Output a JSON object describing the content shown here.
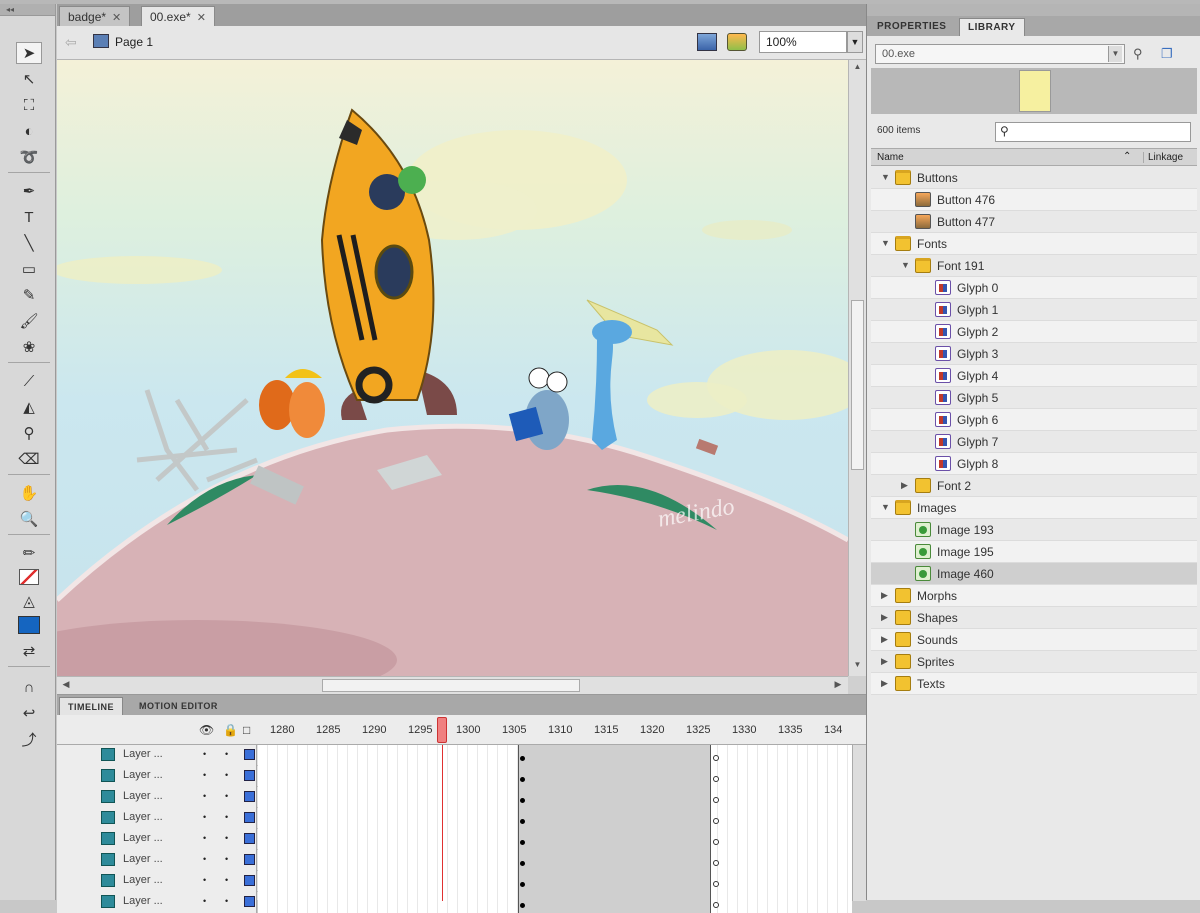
{
  "document_tabs": [
    {
      "label": "badge*",
      "active": false
    },
    {
      "label": "00.exe*",
      "active": true
    }
  ],
  "editbar": {
    "scene": "Page 1",
    "zoom": "100%"
  },
  "stage": {
    "watermark": "melindo"
  },
  "timeline": {
    "tabs": [
      "TIMELINE",
      "MOTION EDITOR"
    ],
    "frame_numbers": [
      "1280",
      "1285",
      "1290",
      "1295",
      "1300",
      "1305",
      "1310",
      "1315",
      "1320",
      "1325",
      "1330",
      "1335",
      "134"
    ],
    "layers": [
      {
        "name": "Layer ..."
      },
      {
        "name": "Layer ..."
      },
      {
        "name": "Layer ..."
      },
      {
        "name": "Layer ..."
      },
      {
        "name": "Layer ..."
      },
      {
        "name": "Layer ..."
      },
      {
        "name": "Layer ..."
      },
      {
        "name": "Layer ..."
      }
    ]
  },
  "right_panel": {
    "tabs": [
      "PROPERTIES",
      "LIBRARY"
    ],
    "document": "00.exe",
    "item_count": "600 items",
    "search_placeholder": "",
    "columns": {
      "name": "Name",
      "linkage": "Linkage"
    },
    "items": [
      {
        "label": "Buttons",
        "type": "folder-open",
        "depth": 0,
        "twisty": "▼"
      },
      {
        "label": "Button 476",
        "type": "button",
        "depth": 1,
        "twisty": ""
      },
      {
        "label": "Button 477",
        "type": "button",
        "depth": 1,
        "twisty": ""
      },
      {
        "label": "Fonts",
        "type": "folder-open",
        "depth": 0,
        "twisty": "▼"
      },
      {
        "label": "Font 191",
        "type": "folder-open",
        "depth": 1,
        "twisty": "▼"
      },
      {
        "label": "Glyph 0",
        "type": "glyph",
        "depth": 2,
        "twisty": ""
      },
      {
        "label": "Glyph 1",
        "type": "glyph",
        "depth": 2,
        "twisty": ""
      },
      {
        "label": "Glyph 2",
        "type": "glyph",
        "depth": 2,
        "twisty": ""
      },
      {
        "label": "Glyph 3",
        "type": "glyph",
        "depth": 2,
        "twisty": ""
      },
      {
        "label": "Glyph 4",
        "type": "glyph",
        "depth": 2,
        "twisty": ""
      },
      {
        "label": "Glyph 5",
        "type": "glyph",
        "depth": 2,
        "twisty": ""
      },
      {
        "label": "Glyph 6",
        "type": "glyph",
        "depth": 2,
        "twisty": ""
      },
      {
        "label": "Glyph 7",
        "type": "glyph",
        "depth": 2,
        "twisty": ""
      },
      {
        "label": "Glyph 8",
        "type": "glyph",
        "depth": 2,
        "twisty": ""
      },
      {
        "label": "Font 2",
        "type": "folder",
        "depth": 1,
        "twisty": "▶"
      },
      {
        "label": "Images",
        "type": "folder-open",
        "depth": 0,
        "twisty": "▼"
      },
      {
        "label": "Image 193",
        "type": "image",
        "depth": 1,
        "twisty": ""
      },
      {
        "label": "Image 195",
        "type": "image",
        "depth": 1,
        "twisty": ""
      },
      {
        "label": "Image 460",
        "type": "image",
        "depth": 1,
        "twisty": "",
        "selected": true
      },
      {
        "label": "Morphs",
        "type": "folder",
        "depth": 0,
        "twisty": "▶"
      },
      {
        "label": "Shapes",
        "type": "folder",
        "depth": 0,
        "twisty": "▶"
      },
      {
        "label": "Sounds",
        "type": "folder",
        "depth": 0,
        "twisty": "▶"
      },
      {
        "label": "Sprites",
        "type": "folder",
        "depth": 0,
        "twisty": "▶"
      },
      {
        "label": "Texts",
        "type": "folder",
        "depth": 0,
        "twisty": "▶"
      }
    ]
  },
  "colors": {
    "fill": "#1565c0",
    "playhead": "#e03030",
    "layer_outline": "#3a6fd8"
  }
}
